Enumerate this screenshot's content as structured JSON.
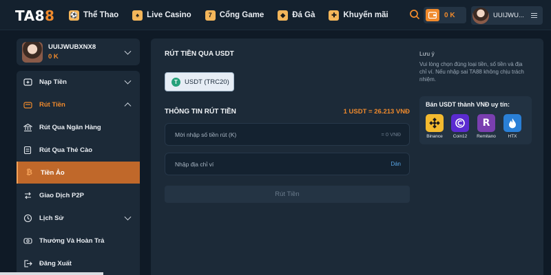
{
  "header": {
    "logo_main": "TA8",
    "logo_accent": "8",
    "nav": [
      {
        "label": "Thể Thao",
        "icon": "football-icon"
      },
      {
        "label": "Live Casino",
        "icon": "cards-icon"
      },
      {
        "label": "Cổng Game",
        "icon": "slot-machine-icon"
      },
      {
        "label": "Đá Gà",
        "icon": "rooster-icon"
      },
      {
        "label": "Khuyến mãi",
        "icon": "gift-icon"
      }
    ],
    "balance": "0 K",
    "username": "UUIJWU..."
  },
  "profile": {
    "name": "UUIJWUBXNX8",
    "balance": "0 K"
  },
  "sidebar": {
    "items": [
      {
        "label": "Nạp Tiền",
        "icon": "deposit-icon"
      },
      {
        "label": "Rút Tiền",
        "icon": "withdraw-icon"
      },
      {
        "label": "Rút Qua Ngân Hàng",
        "icon": "bank-icon"
      },
      {
        "label": "Rút Qua Thẻ Cào",
        "icon": "card-icon"
      },
      {
        "label": "Tiền Ảo",
        "icon": "bitcoin-icon"
      },
      {
        "label": "Giao Dịch P2P",
        "icon": "p2p-icon"
      },
      {
        "label": "Lịch Sử",
        "icon": "history-icon"
      },
      {
        "label": "Thưởng Và Hoàn Trả",
        "icon": "reward-icon"
      },
      {
        "label": "Đăng Xuất",
        "icon": "logout-icon"
      }
    ]
  },
  "main": {
    "title": "RÚT TIỀN QUA USDT",
    "network_button": "USDT (TRC20)",
    "info_title": "THÔNG TIN RÚT TIỀN",
    "rate": "1 USDT = 26.213 VNĐ",
    "amount": {
      "placeholder": "Mời nhập số tiền rút (K)",
      "suffix": "= 0 VNĐ"
    },
    "wallet": {
      "placeholder": "Nhập địa chỉ ví",
      "paste": "Dán"
    },
    "submit": "Rút Tiền"
  },
  "note": {
    "title": "Lưu ý",
    "text": "Vui lòng chọn đúng loại tiền, số tiền và địa chỉ ví. Nếu nhập sai TA88 không chịu trách nhiệm."
  },
  "partners": {
    "title": "Bán USDT thành VNĐ uy tín:",
    "items": [
      {
        "name": "Binance",
        "color": "#f3ba2f"
      },
      {
        "name": "Coin12",
        "color": "#5b2bd1"
      },
      {
        "name": "Remitano",
        "color": "#7a3fb0"
      },
      {
        "name": "HTX",
        "color": "#2a7fd6"
      }
    ]
  },
  "colors": {
    "accent": "#f08a2c",
    "panel": "#1c2a38",
    "background": "#0f1a26"
  }
}
